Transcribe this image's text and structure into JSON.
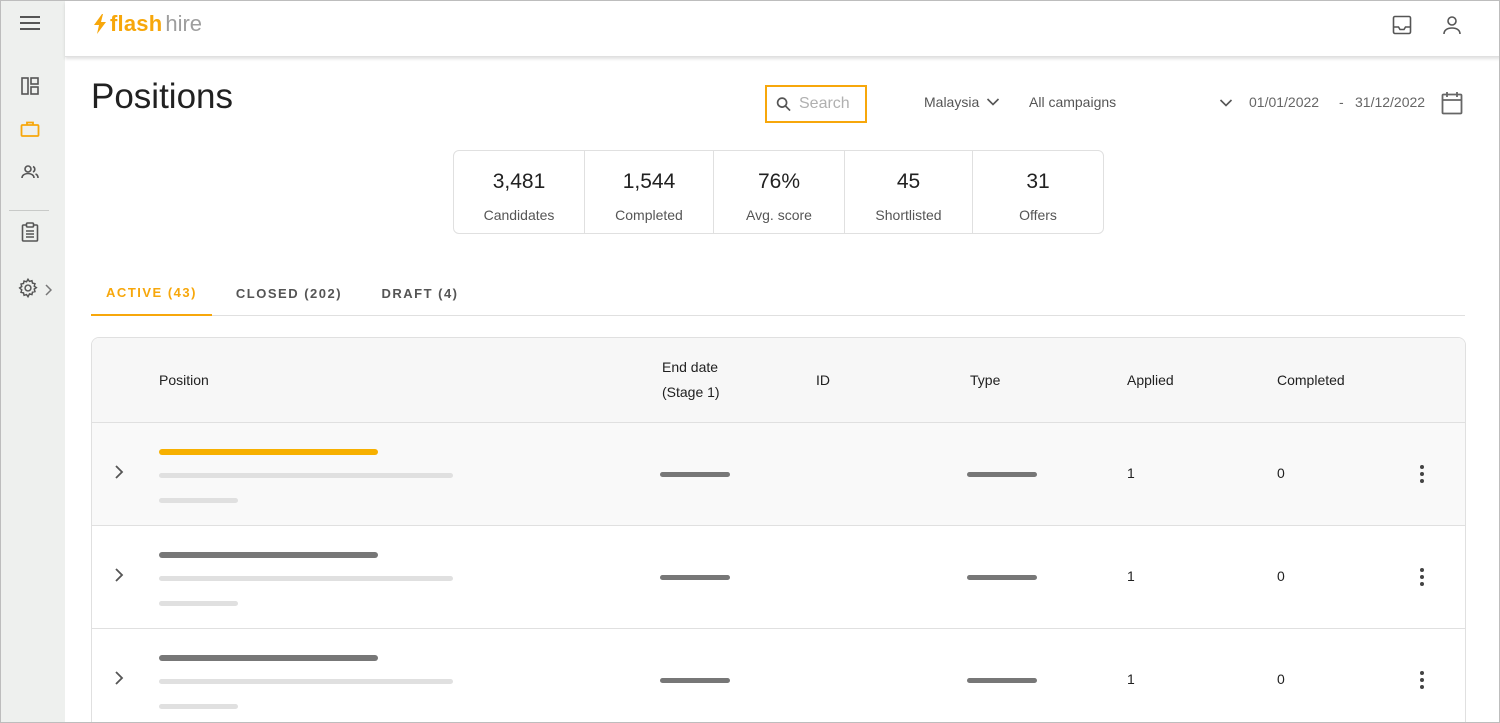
{
  "app": {
    "logo_flash": "flash",
    "logo_hire": "hire"
  },
  "page": {
    "title": "Positions"
  },
  "search": {
    "placeholder": "Search",
    "value": ""
  },
  "filters": {
    "country": "Malaysia",
    "campaign": "All campaigns",
    "date_from": "01/01/2022",
    "date_separator": "-",
    "date_to": "31/12/2022"
  },
  "stats": [
    {
      "value": "3,481",
      "label": "Candidates"
    },
    {
      "value": "1,544",
      "label": "Completed"
    },
    {
      "value": "76%",
      "label": "Avg. score"
    },
    {
      "value": "45",
      "label": "Shortlisted"
    },
    {
      "value": "31",
      "label": "Offers"
    }
  ],
  "tabs": [
    {
      "label": "ACTIVE (43)",
      "active": true
    },
    {
      "label": "CLOSED (202)",
      "active": false
    },
    {
      "label": "DRAFT (4)",
      "active": false
    }
  ],
  "table": {
    "headers": {
      "position": "Position",
      "end_date_line1": "End date",
      "end_date_line2": "(Stage 1)",
      "id": "ID",
      "type": "Type",
      "applied": "Applied",
      "completed": "Completed"
    },
    "rows": [
      {
        "applied": "1",
        "completed": "0",
        "highlighted": true
      },
      {
        "applied": "1",
        "completed": "0",
        "highlighted": false
      },
      {
        "applied": "1",
        "completed": "0",
        "highlighted": false
      }
    ]
  },
  "colors": {
    "accent": "#f7a70b",
    "sidebar_bg": "#eef0ee",
    "placeholder_bar": "#777777",
    "light_bar": "#e0e0e0"
  }
}
